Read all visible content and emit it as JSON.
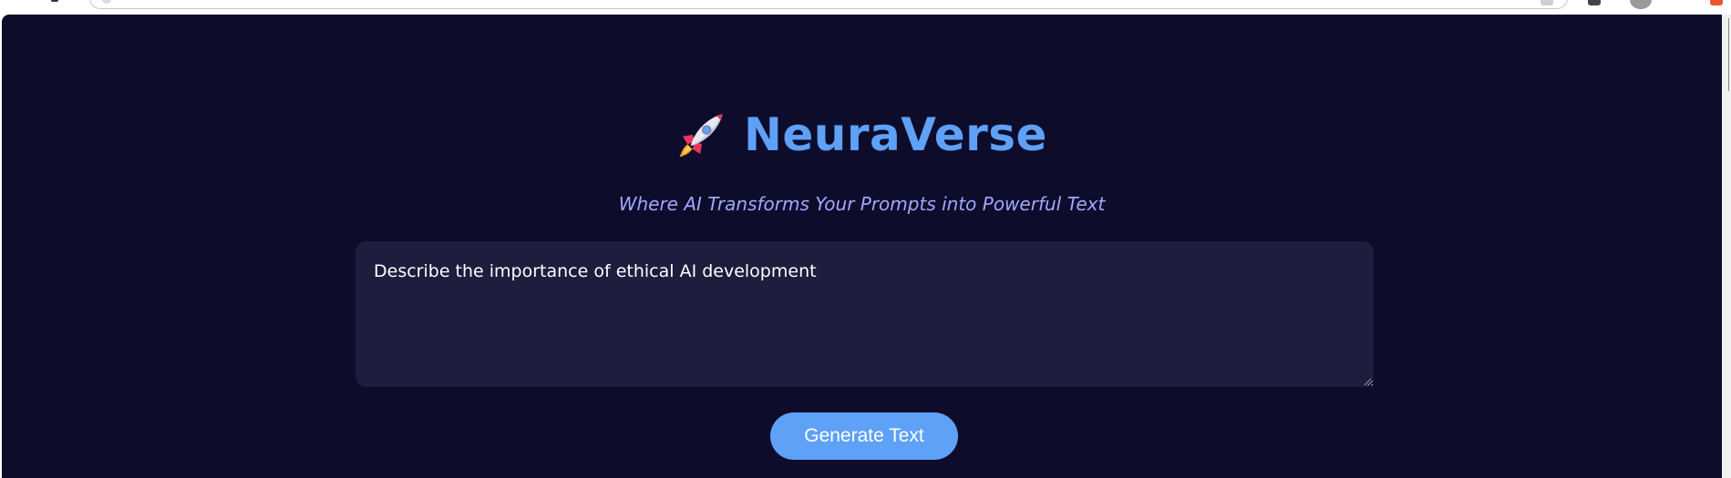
{
  "app": {
    "title": "NeuraVerse",
    "tagline": "Where AI Transforms Your Prompts into Powerful Text",
    "logo_icon": "rocket-icon"
  },
  "prompt": {
    "value": "Describe the importance of ethical AI development"
  },
  "actions": {
    "generate_label": "Generate Text"
  },
  "colors": {
    "background": "#0d0d2b",
    "accent": "#5ea1f7",
    "tagline": "#a3a6ff",
    "input_bg": "#1d1d3d"
  }
}
